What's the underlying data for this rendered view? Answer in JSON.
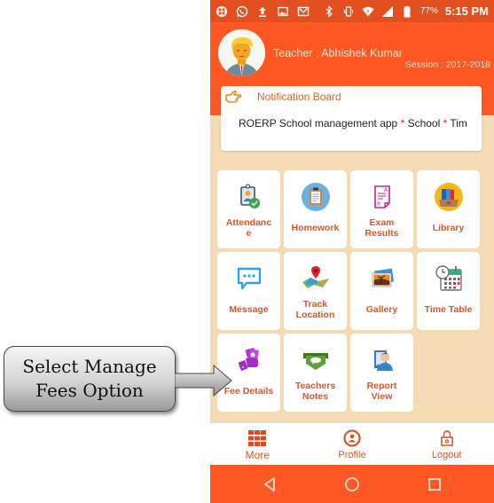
{
  "status_bar": {
    "left_icons": [
      "app-grid-icon",
      "whatsapp-icon",
      "upload-icon",
      "image-icon",
      "gmail-icon"
    ],
    "right_icons": [
      "bluetooth-icon",
      "vibrate-icon",
      "wifi-icon",
      "cell-signal-icon",
      "battery-icon"
    ],
    "battery": "77%",
    "time": "5:15 PM"
  },
  "header": {
    "teacher": "Teacher : Abhishek Kumar",
    "session": "Session : 2017-2018"
  },
  "notification": {
    "title": "Notification Board",
    "ticker_parts": [
      "ROERP School management app ",
      "*",
      " School ",
      "*",
      " Tim"
    ]
  },
  "tiles": [
    {
      "id": "attendance",
      "icon": "attendance-icon",
      "lines": [
        "Attendanc",
        "e"
      ]
    },
    {
      "id": "homework",
      "icon": "homework-icon",
      "lines": [
        "Homework"
      ]
    },
    {
      "id": "exam-results",
      "icon": "exam-results-icon",
      "lines": [
        "Exam",
        "Results"
      ]
    },
    {
      "id": "library",
      "icon": "library-icon",
      "lines": [
        "Library"
      ]
    },
    {
      "id": "message",
      "icon": "message-icon",
      "lines": [
        "Message"
      ]
    },
    {
      "id": "track-location",
      "icon": "map-location-icon",
      "lines": [
        "Track",
        "Location"
      ]
    },
    {
      "id": "gallery",
      "icon": "gallery-icon",
      "lines": [
        "Gallery"
      ]
    },
    {
      "id": "time-table",
      "icon": "calendar-clock-icon",
      "lines": [
        "Time Table"
      ]
    },
    {
      "id": "fee-details",
      "icon": "fee-money-icon",
      "lines": [
        "Fee Details"
      ]
    },
    {
      "id": "teachers-notes",
      "icon": "notes-icon",
      "lines": [
        "Teachers",
        "Notes"
      ]
    },
    {
      "id": "report-view",
      "icon": "report-view-icon",
      "lines": [
        "Report",
        "View"
      ]
    }
  ],
  "bottom_nav": [
    {
      "id": "more",
      "label": "More",
      "icon": "grid-icon"
    },
    {
      "id": "profile",
      "label": "Profile",
      "icon": "profile-icon"
    },
    {
      "id": "logout",
      "label": "Logout",
      "icon": "lock-icon"
    }
  ],
  "system_nav": [
    "back-icon",
    "home-icon",
    "recents-icon"
  ],
  "callout": {
    "line1": "Select Manage",
    "line2": "Fees Option"
  },
  "colors": {
    "status_bar": "#e44f1f",
    "header": "#fd5823",
    "accent_text": "#e2531f",
    "background": "#f4dbb6"
  }
}
